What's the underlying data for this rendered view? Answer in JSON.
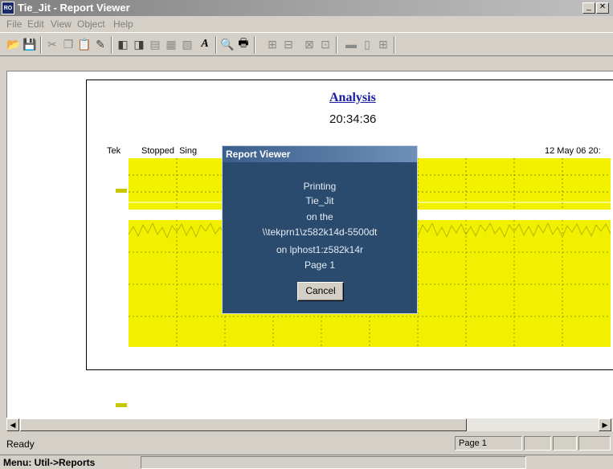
{
  "window": {
    "icon_text": "RO",
    "title": "Tie_Jit - Report Viewer",
    "min_glyph": "_",
    "close_glyph": "✕"
  },
  "menu": [
    "File",
    "Edit",
    "View",
    "Object",
    "Help"
  ],
  "toolbar": {
    "icons": [
      "open-icon",
      "save-icon",
      "cut-icon",
      "copy-icon",
      "paste-icon",
      "eraser-icon",
      "bring-front-icon",
      "send-back-icon",
      "group-icon",
      "align-icon",
      "distribute-icon",
      "text-icon",
      "print-preview-icon",
      "print-icon",
      "space-h-icon",
      "space-v-icon",
      "center-h-icon",
      "center-v-icon",
      "size-width-icon",
      "size-height-icon",
      "size-both-icon"
    ]
  },
  "report": {
    "title_fragment": "Analysis",
    "time_fragment": "20:34:36",
    "scope_header_left": "Tek",
    "scope_header_state": "Stopped  Sing",
    "scope_header_date": "12 May 06 20:"
  },
  "dialog": {
    "title": "Report Viewer",
    "lines": [
      "Printing",
      "Tie_Jit",
      "on the",
      "\\\\tekprn1\\z582k14d-5500dt",
      "on lphost1:z582k14r",
      "Page 1"
    ],
    "cancel_label": "Cancel"
  },
  "status": {
    "text": "Ready",
    "page": "Page 1"
  },
  "bottom": {
    "text": "Menu: Util->Reports"
  },
  "colors": {
    "dialog_bg": "#2a4a6e",
    "trace_yellow": "#f2f200",
    "report_link": "#1a1aa0"
  }
}
